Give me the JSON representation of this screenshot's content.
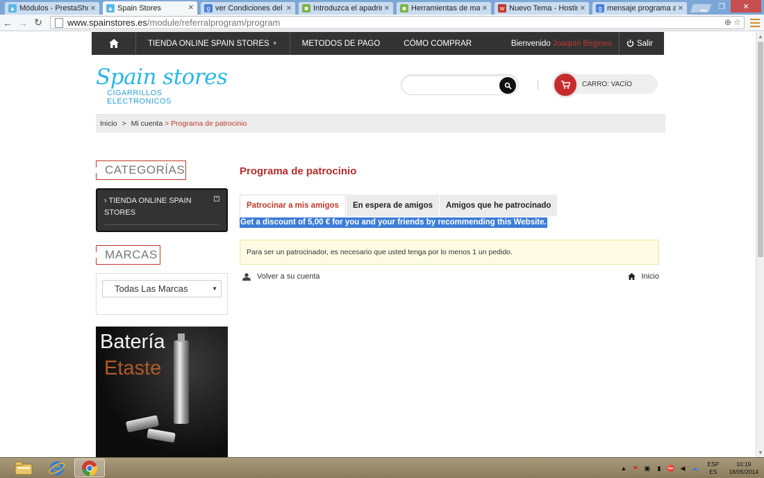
{
  "browser": {
    "tabs": [
      {
        "title": "Módulos - PrestaShop™",
        "active": false
      },
      {
        "title": "Spain Stores",
        "active": true
      },
      {
        "title": "ver Condiciones del pro",
        "active": false
      },
      {
        "title": "Introduzca el apadrinam",
        "active": false
      },
      {
        "title": "Herramientas de market",
        "active": false
      },
      {
        "title": "Nuevo Tema - Hosting",
        "active": false
      },
      {
        "title": "mensaje programa apad",
        "active": false
      }
    ],
    "url_host": "www.spainstores.es",
    "url_path": "/module/referralprogram/program"
  },
  "topnav": {
    "items": [
      "TIENDA ONLINE SPAIN STORES",
      "METODOS DE PAGO",
      "CÓMO COMPRAR"
    ],
    "welcome": "Bienvenido",
    "user": "Joaquin Begines",
    "logout": "Salir"
  },
  "header": {
    "logo_main": "Spain stores",
    "logo_sub": "CIGARRILLOS ELECTRONICOS",
    "search_placeholder": "",
    "cart_label": "CARRO: VACÍO"
  },
  "breadcrumb": {
    "home": "Inicio",
    "account": "Mi cuenta",
    "current": "Programa de patrocinio",
    "separator": ">"
  },
  "sidebar": {
    "categories_title": "CATEGORÍAS",
    "category_item": "TIENDA ONLINE SPAIN STORES",
    "brands_title": "MARCAS",
    "brand_select": "Todas Las Marcas",
    "banner_line1": "Batería",
    "banner_line2": "Etaste"
  },
  "content": {
    "title": "Programa de patrocinio",
    "tabs": [
      "Patrocinar a mis amigos",
      "En espera de amigos",
      "Amigos que he patrocinado"
    ],
    "discount_text": "Get a discount of 5,00 € for you and your friends by recommending this Website.",
    "alert": "Para ser un patrocinador, es necesario que usted tenga por lo menos 1 un pedido.",
    "back_link": "Volver a su cuenta",
    "home_link": "Inicio"
  },
  "taskbar": {
    "lang_top": "ESP",
    "lang_bottom": "ES",
    "time": "10:19",
    "date": "18/05/2014"
  },
  "colors": {
    "accent_red": "#c0392b",
    "nav_bg": "#333333",
    "logo_blue": "#29b6e8",
    "selection_blue": "#3d7dd8"
  }
}
